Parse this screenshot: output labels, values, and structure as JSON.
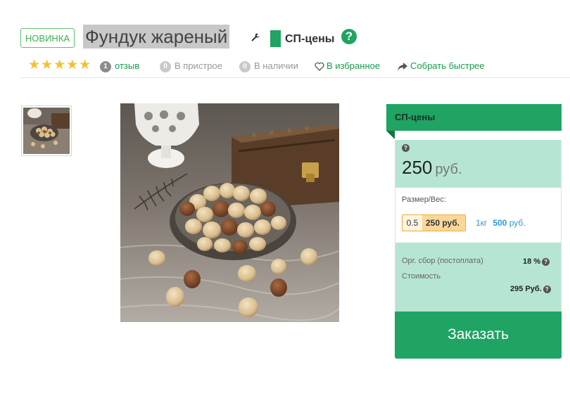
{
  "product": {
    "badge": "НОВИНКА",
    "title": "Фундук жареный",
    "sp_label": "СП-цены",
    "help_symbol": "?"
  },
  "meta": {
    "rating": 5,
    "stars": "★★★★★",
    "reviews_count": "1",
    "reviews_label": "отзыв",
    "prestore_count": "0",
    "prestore_label": "В пристрое",
    "stock_count": "0",
    "stock_label": "В наличии",
    "favorite_label": "В избранное",
    "quick_label": "Собрать быстрее"
  },
  "panel": {
    "header": "СП-цены",
    "price_value": "250",
    "price_currency": "руб.",
    "size_label": "Размер/Вес:",
    "options": [
      {
        "weight": "0.5",
        "price": "250 руб.",
        "selected": true
      },
      {
        "weight": "1кг",
        "price_num": "500",
        "price_cur": "руб.",
        "selected": false
      }
    ],
    "fee_label": "Орг. сбор (постоплата)",
    "fee_value": "18 %",
    "cost_label": "Стоимость",
    "cost_value": "295 Руб.",
    "order_button": "Заказать"
  },
  "colors": {
    "accent": "#1fa463",
    "light_green": "#b6e6d2",
    "link_blue": "#2b9ad4",
    "star": "#f2c230"
  },
  "icons": [
    "wrench-icon",
    "help-icon",
    "star-icon",
    "heart-icon",
    "share-arrow-icon",
    "question-icon"
  ]
}
